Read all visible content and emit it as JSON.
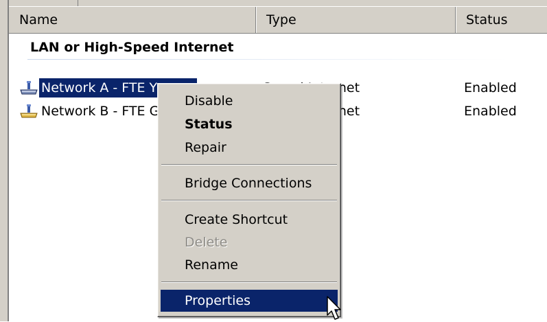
{
  "columns": {
    "name": "Name",
    "type": "Type",
    "status": "Status"
  },
  "group": {
    "title": "LAN or High-Speed Internet"
  },
  "connections": [
    {
      "name": "Network A - FTE Yellow",
      "name_visible": "Network A - FTE Y",
      "type": "LAN or High-Speed Internet",
      "type_visible": "Speed Internet",
      "status": "Enabled",
      "selected": true,
      "icon": "network-connection-icon"
    },
    {
      "name": "Network B - FTE G",
      "name_visible": "Network B - FTE G",
      "type": "LAN or High-Speed Internet",
      "type_visible": "Speed Internet",
      "status": "Enabled",
      "selected": false,
      "icon": "network-connection-icon"
    }
  ],
  "context_menu": {
    "items": [
      {
        "label": "Disable",
        "style": "normal"
      },
      {
        "label": "Status",
        "style": "bold"
      },
      {
        "label": "Repair",
        "style": "normal"
      },
      {
        "label": "Bridge Connections",
        "style": "normal"
      },
      {
        "label": "Create Shortcut",
        "style": "normal"
      },
      {
        "label": "Delete",
        "style": "disabled"
      },
      {
        "label": "Rename",
        "style": "normal"
      },
      {
        "label": "Properties",
        "style": "highlighted"
      }
    ]
  },
  "colors": {
    "selection": "#0a246a",
    "chrome": "#d4d0c8",
    "disabled_text": "#8e8c87"
  },
  "icons": [
    "network-connection-icon",
    "mouse-pointer-icon"
  ]
}
